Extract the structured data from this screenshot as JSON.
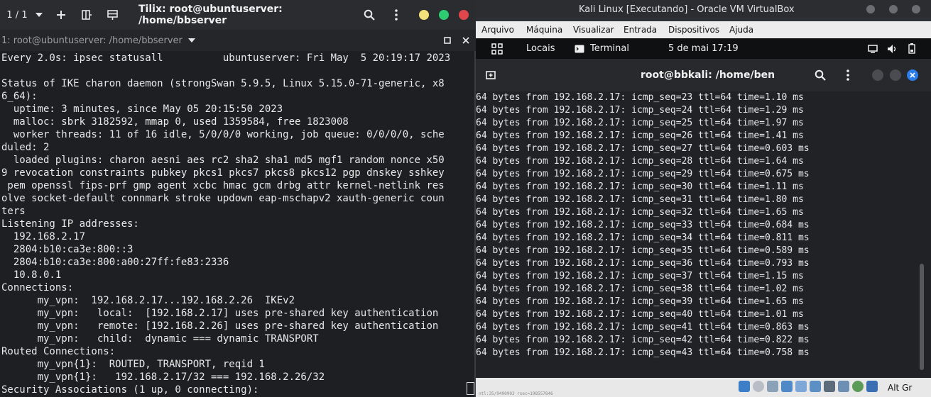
{
  "tilix": {
    "session_counter": "1 / 1",
    "title": "Tilix: root@ubuntuserver: /home/bbserver",
    "terminal_title": "1: root@ubuntuserver: /home/bbserver",
    "lines": [
      "Every 2.0s: ipsec statusall          ubuntuserver: Fri May  5 20:19:17 2023",
      "",
      "Status of IKE charon daemon (strongSwan 5.9.5, Linux 5.15.0-71-generic, x8",
      "6_64):",
      "  uptime: 3 minutes, since May 05 20:15:50 2023",
      "  malloc: sbrk 3182592, mmap 0, used 1359584, free 1823008",
      "  worker threads: 11 of 16 idle, 5/0/0/0 working, job queue: 0/0/0/0, sche",
      "duled: 2",
      "  loaded plugins: charon aesni aes rc2 sha2 sha1 md5 mgf1 random nonce x50",
      "9 revocation constraints pubkey pkcs1 pkcs7 pkcs8 pkcs12 pgp dnskey sshkey",
      " pem openssl fips-prf gmp agent xcbc hmac gcm drbg attr kernel-netlink res",
      "olve socket-default connmark stroke updown eap-mschapv2 xauth-generic coun",
      "ters",
      "Listening IP addresses:",
      "  192.168.2.17",
      "  2804:b10:ca3e:800::3",
      "  2804:b10:ca3e:800:a00:27ff:fe83:2336",
      "  10.8.0.1",
      "Connections:",
      "      my_vpn:  192.168.2.17...192.168.2.26  IKEv2",
      "      my_vpn:   local:  [192.168.2.17] uses pre-shared key authentication",
      "      my_vpn:   remote: [192.168.2.26] uses pre-shared key authentication",
      "      my_vpn:   child:  dynamic === dynamic TRANSPORT",
      "Routed Connections:",
      "      my_vpn{1}:  ROUTED, TRANSPORT, reqid 1",
      "      my_vpn{1}:   192.168.2.17/32 === 192.168.2.26/32",
      "Security Associations (1 up, 0 connecting):"
    ]
  },
  "vbox": {
    "title": "Kali Linux [Executando] - Oracle VM VirtualBox",
    "menu": [
      "Arquivo",
      "Máquina",
      "Visualizar",
      "Entrada",
      "Dispositivos",
      "Ajuda"
    ],
    "panel": {
      "places": "Locais",
      "terminal": "Terminal",
      "clock": "5 de mai  17:19"
    },
    "terminal_title": "root@bbkali: /home/ben",
    "lines": [
      "64 bytes from 192.168.2.17: icmp_seq=23 ttl=64 time=1.10 ms",
      "64 bytes from 192.168.2.17: icmp_seq=24 ttl=64 time=1.29 ms",
      "64 bytes from 192.168.2.17: icmp_seq=25 ttl=64 time=1.97 ms",
      "64 bytes from 192.168.2.17: icmp_seq=26 ttl=64 time=1.41 ms",
      "64 bytes from 192.168.2.17: icmp_seq=27 ttl=64 time=0.603 ms",
      "64 bytes from 192.168.2.17: icmp_seq=28 ttl=64 time=1.64 ms",
      "64 bytes from 192.168.2.17: icmp_seq=29 ttl=64 time=0.675 ms",
      "64 bytes from 192.168.2.17: icmp_seq=30 ttl=64 time=1.11 ms",
      "64 bytes from 192.168.2.17: icmp_seq=31 ttl=64 time=1.80 ms",
      "64 bytes from 192.168.2.17: icmp_seq=32 ttl=64 time=1.65 ms",
      "64 bytes from 192.168.2.17: icmp_seq=33 ttl=64 time=0.684 ms",
      "64 bytes from 192.168.2.17: icmp_seq=34 ttl=64 time=0.811 ms",
      "64 bytes from 192.168.2.17: icmp_seq=35 ttl=64 time=0.589 ms",
      "64 bytes from 192.168.2.17: icmp_seq=36 ttl=64 time=0.793 ms",
      "64 bytes from 192.168.2.17: icmp_seq=37 ttl=64 time=1.15 ms",
      "64 bytes from 192.168.2.17: icmp_seq=38 ttl=64 time=1.02 ms",
      "64 bytes from 192.168.2.17: icmp_seq=39 ttl=64 time=1.65 ms",
      "64 bytes from 192.168.2.17: icmp_seq=40 ttl=64 time=1.01 ms",
      "64 bytes from 192.168.2.17: icmp_seq=41 ttl=64 time=0.863 ms",
      "64 bytes from 192.168.2.17: icmp_seq=42 ttl=64 time=0.822 ms",
      "64 bytes from 192.168.2.17: icmp_seq=43 ttl=64 time=0.758 ms"
    ],
    "status_text": "ntl:35/9490903 rsec=198557846",
    "host_key": "Alt Gr"
  },
  "colors": {
    "tilix_close": "#e0474c",
    "tilix_maximize": "#2ecc71",
    "tilix_minimize": "#f4e07a",
    "kali_close": "#2b7de9"
  },
  "icons": {
    "tilix_header": [
      "chevron-down-icon",
      "plus-icon",
      "split-right-icon",
      "split-down-icon",
      "search-icon",
      "menu-icon"
    ],
    "kali_panel": [
      "apps-grid-icon",
      "terminal-icon",
      "screen-icon",
      "volume-icon",
      "battery-icon"
    ],
    "kali_term": [
      "new-tab-icon",
      "search-icon",
      "menu-icon"
    ],
    "vbox_status": [
      "hdd-icon",
      "optical-icon",
      "audio-icon",
      "network-icon",
      "usb-icon",
      "shared-folder-icon",
      "display-icon",
      "recording-icon",
      "mouse-icon",
      "host-key-icon"
    ]
  }
}
